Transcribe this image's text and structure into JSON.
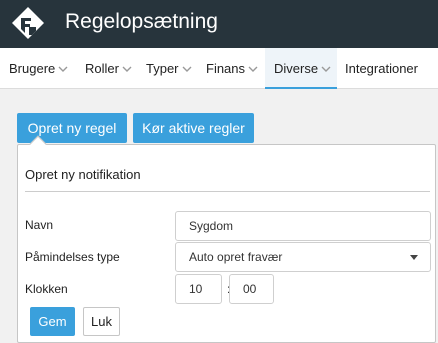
{
  "app": {
    "title": "Regelopsætning"
  },
  "nav": {
    "items": [
      {
        "label": "Brugere"
      },
      {
        "label": "Roller"
      },
      {
        "label": "Typer"
      },
      {
        "label": "Finans"
      },
      {
        "label": "Diverse"
      },
      {
        "label": "Integrationer"
      }
    ],
    "active_index": 4,
    "accent": "#3aa0dc"
  },
  "actions": {
    "create_rule": "Opret ny regel",
    "run_active_rules": "Kør aktive regler"
  },
  "form": {
    "title": "Opret ny notifikation",
    "name_label": "Navn",
    "name_value": "Sygdom",
    "reminder_type_label": "Påmindelses type",
    "reminder_type_value": "Auto opret fravær",
    "time_label": "Klokken",
    "hour": "10",
    "minute": "00",
    "time_separator": ":",
    "save": "Gem",
    "close": "Luk"
  },
  "colors": {
    "header_bg": "#27343c",
    "primary": "#3aa0dc",
    "page_bg": "#f1f1f1"
  }
}
